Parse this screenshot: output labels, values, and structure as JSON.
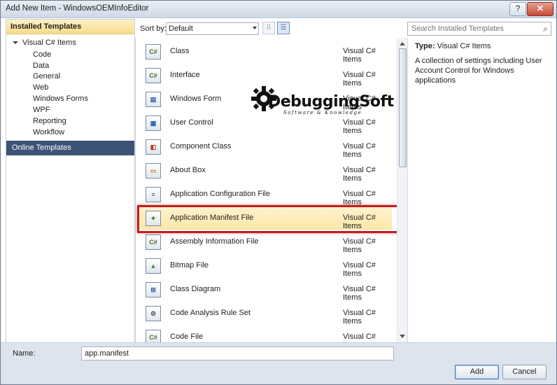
{
  "window": {
    "title": "Add New Item - WindowsOEMInfoEditor",
    "help_label": "?",
    "close_label": "✕"
  },
  "left_panel": {
    "header": "Installed Templates",
    "root": "Visual C# Items",
    "children": [
      "Code",
      "Data",
      "General",
      "Web",
      "Windows Forms",
      "WPF",
      "Reporting",
      "Workflow"
    ],
    "online": "Online Templates"
  },
  "toolbar": {
    "sort_label": "Sort by:",
    "sort_value": "Default",
    "search_placeholder": "Search Installed Templates"
  },
  "templates": [
    {
      "name": "Class",
      "type": "Visual C# Items",
      "icon": "class-icon"
    },
    {
      "name": "Interface",
      "type": "Visual C# Items",
      "icon": "interface-icon"
    },
    {
      "name": "Windows Form",
      "type": "Visual C# Items",
      "icon": "windows-form-icon"
    },
    {
      "name": "User Control",
      "type": "Visual C# Items",
      "icon": "user-control-icon"
    },
    {
      "name": "Component Class",
      "type": "Visual C# Items",
      "icon": "component-class-icon"
    },
    {
      "name": "About Box",
      "type": "Visual C# Items",
      "icon": "about-box-icon"
    },
    {
      "name": "Application Configuration File",
      "type": "Visual C# Items",
      "icon": "config-file-icon"
    },
    {
      "name": "Application Manifest File",
      "type": "Visual C# Items",
      "icon": "manifest-file-icon",
      "selected": true
    },
    {
      "name": "Assembly Information File",
      "type": "Visual C# Items",
      "icon": "assembly-info-icon"
    },
    {
      "name": "Bitmap File",
      "type": "Visual C# Items",
      "icon": "bitmap-file-icon"
    },
    {
      "name": "Class Diagram",
      "type": "Visual C# Items",
      "icon": "class-diagram-icon"
    },
    {
      "name": "Code Analysis Rule Set",
      "type": "Visual C# Items",
      "icon": "rule-set-icon"
    },
    {
      "name": "Code File",
      "type": "Visual C# Items",
      "icon": "code-file-icon"
    }
  ],
  "description": {
    "type_label": "Type:",
    "type_value": "Visual C# Items",
    "text": "A collection of settings including User Account Control for Windows applications"
  },
  "watermark": {
    "title": "DebuggingSoft",
    "subtitle": "Software & Knowledge"
  },
  "bottom": {
    "name_label": "Name:",
    "name_value": "app.manifest",
    "add_label": "Add",
    "cancel_label": "Cancel"
  }
}
